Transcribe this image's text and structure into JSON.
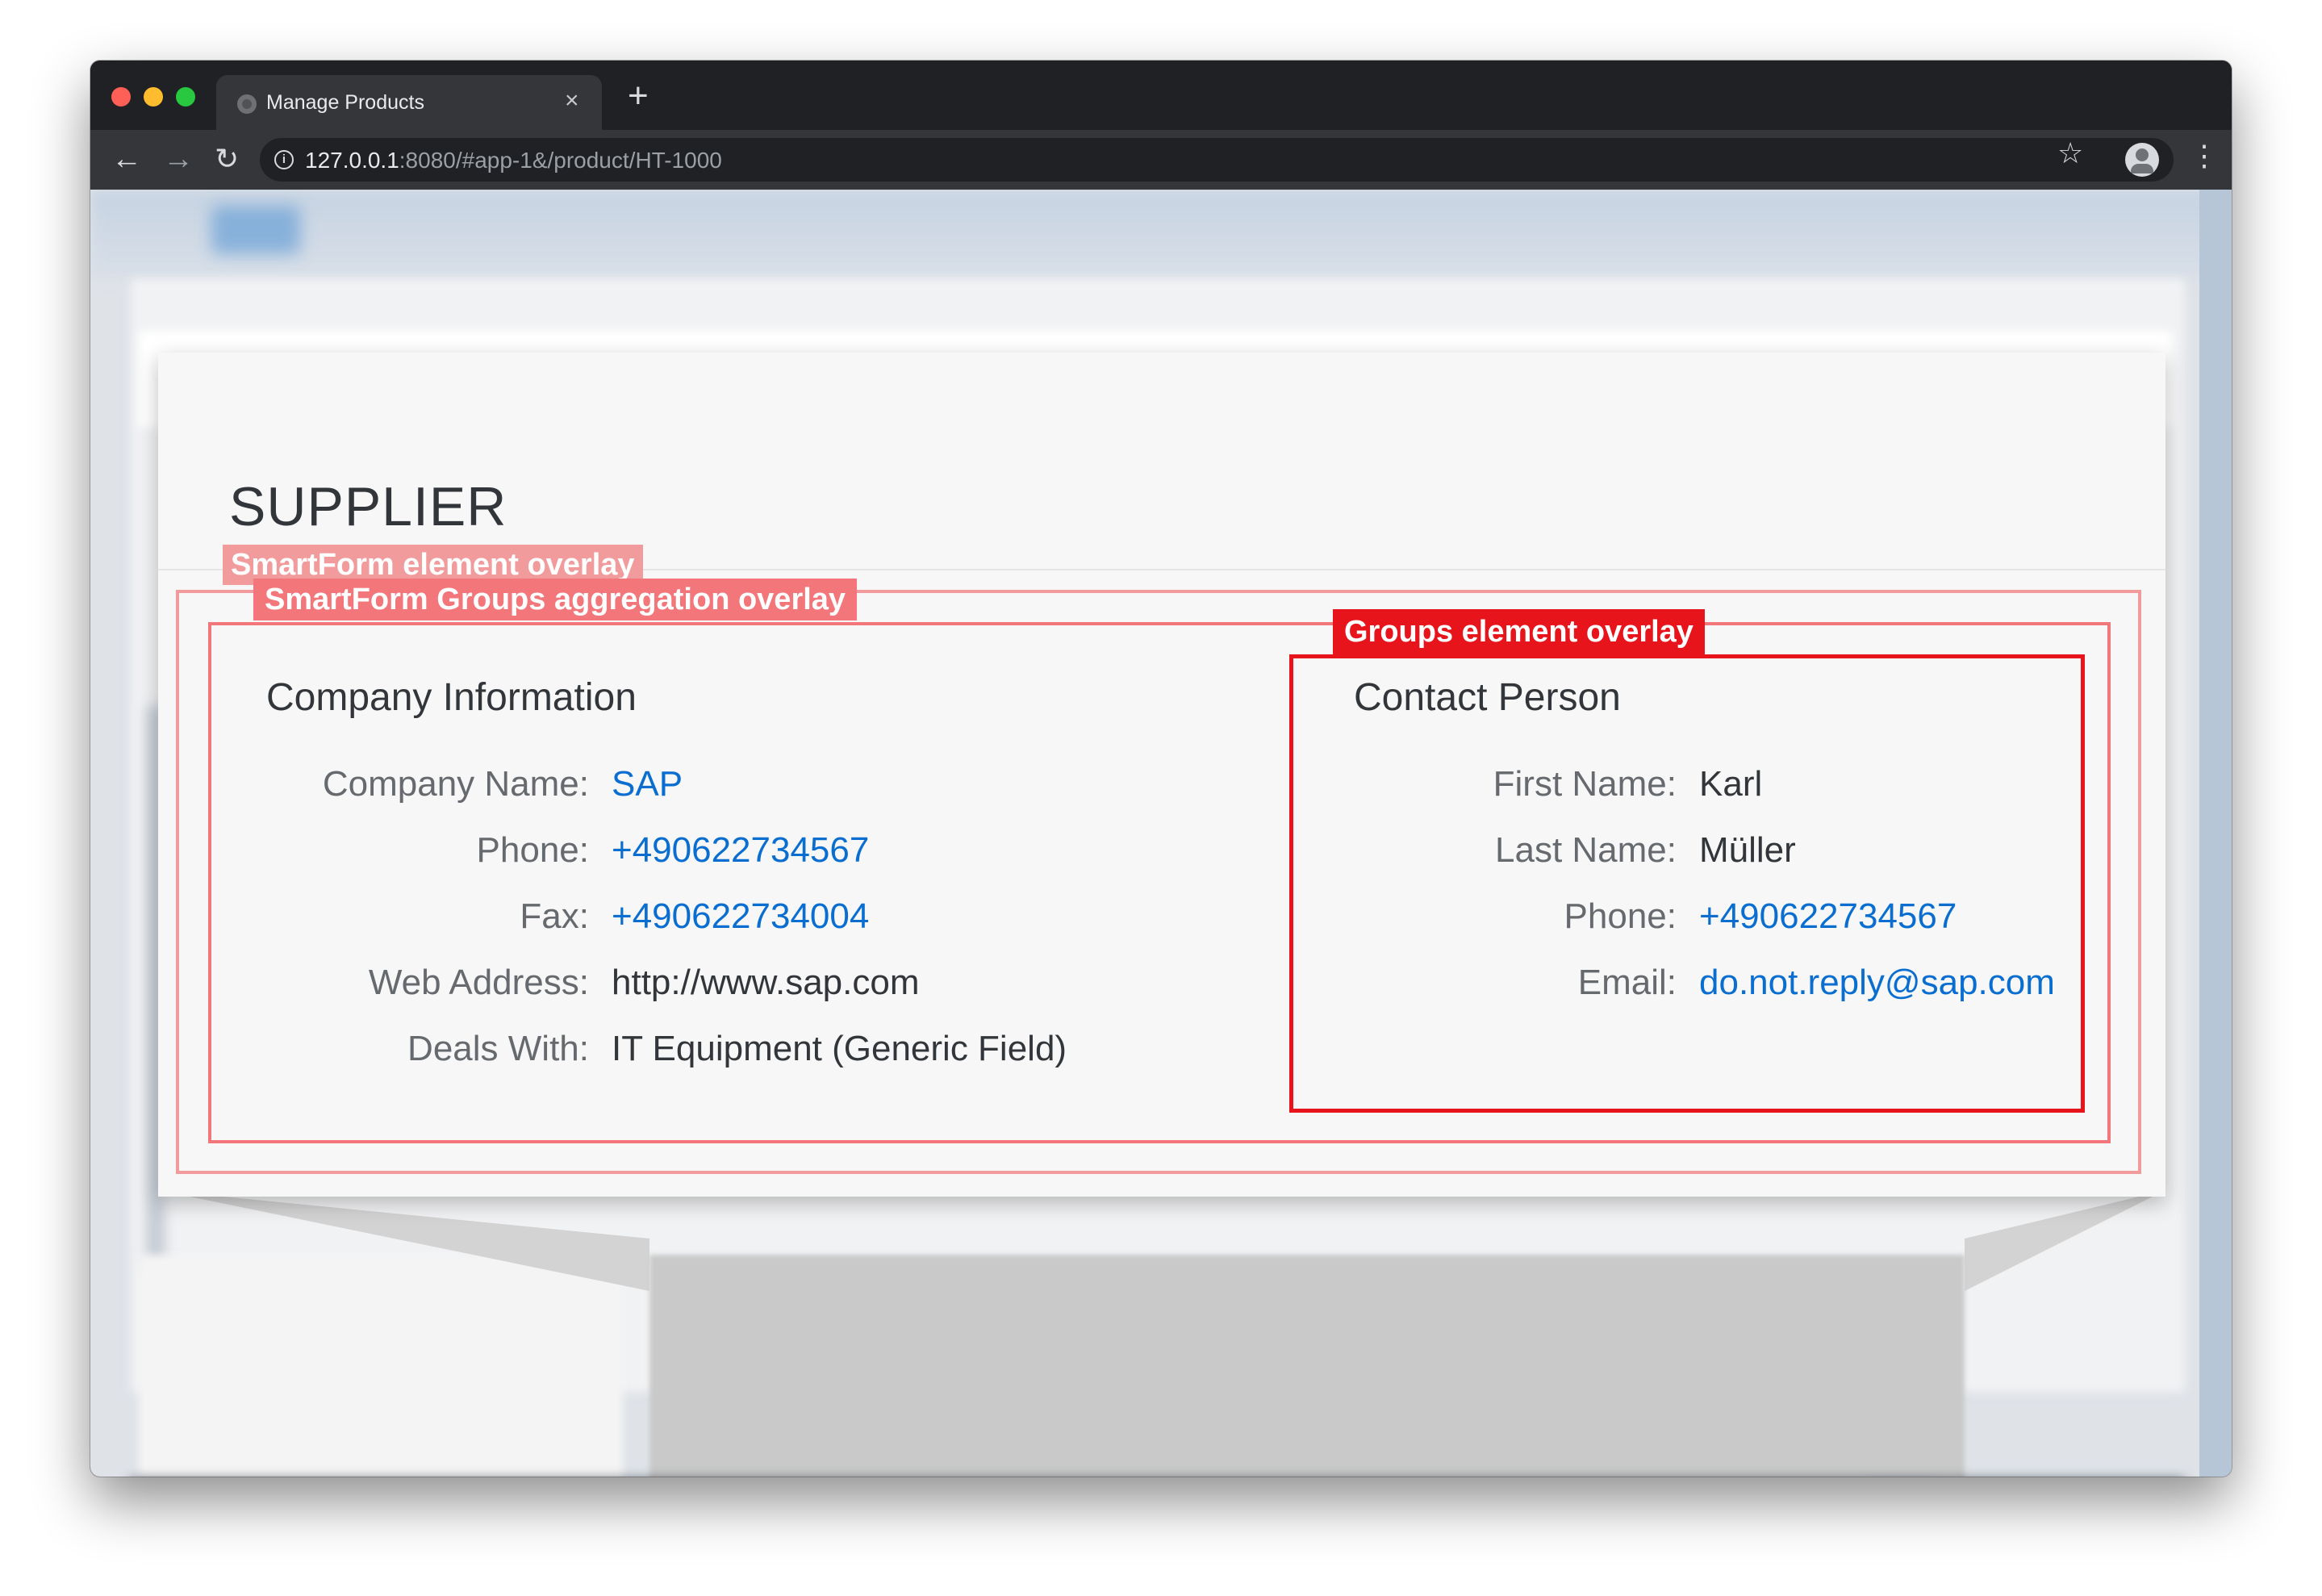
{
  "browser": {
    "tab_title": "Manage Products",
    "tab_close": "×",
    "new_tab": "+",
    "url_host": "127.0.0.1",
    "url_rest": ":8080/#app-1&/product/HT-1000",
    "back": "←",
    "forward": "→",
    "reload": "↻",
    "star": "☆",
    "menu": "⋮",
    "info": "i"
  },
  "card": {
    "title": "SUPPLIER"
  },
  "overlays": {
    "smartform_element": "SmartForm element overlay",
    "groups_aggregation": "SmartForm Groups aggregation overlay",
    "group_element": "Groups element overlay"
  },
  "company": {
    "title": "Company Information",
    "fields": [
      {
        "label": "Company Name:",
        "value": "SAP",
        "link": true
      },
      {
        "label": "Phone:",
        "value": "+490622734567",
        "link": true
      },
      {
        "label": "Fax:",
        "value": "+490622734004",
        "link": true
      },
      {
        "label": "Web Address:",
        "value": "http://www.sap.com",
        "link": false
      },
      {
        "label": "Deals With:",
        "value": "IT Equipment (Generic Field)",
        "link": false
      }
    ]
  },
  "contact": {
    "title": "Contact Person",
    "fields": [
      {
        "label": "First Name:",
        "value": "Karl",
        "link": false
      },
      {
        "label": "Last Name:",
        "value": "Müller",
        "link": false
      },
      {
        "label": "Phone:",
        "value": "+490622734567",
        "link": true
      },
      {
        "label": "Email:",
        "value": "do.not.reply@sap.com",
        "link": true
      }
    ]
  },
  "colors": {
    "link": "#0a6ed1",
    "overlay_light": "#f29b9d",
    "overlay_medium": "#f2767a",
    "overlay_strong": "#e8141b"
  }
}
